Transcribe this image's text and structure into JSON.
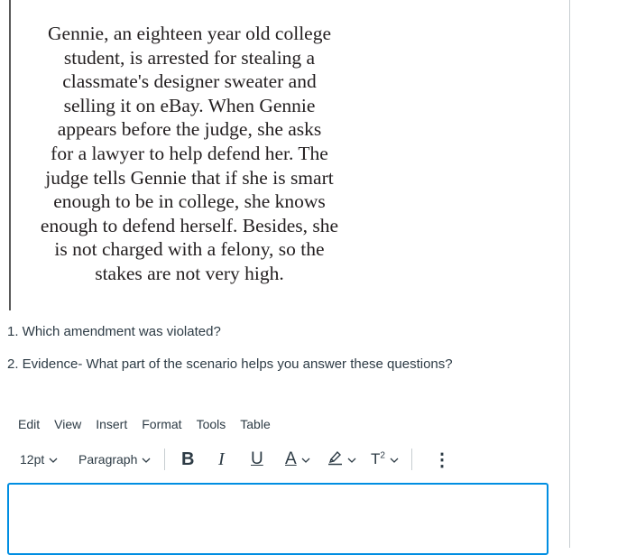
{
  "scenario": {
    "lines": [
      "Gennie, an eighteen year old college",
      "student, is arrested for stealing a",
      "classmate's designer sweater and",
      "selling it on eBay. When Gennie",
      "appears before the judge, she asks",
      "for a lawyer to help defend her. The",
      "judge tells Gennie that if she is smart",
      "enough to be in college, she knows",
      "enough to defend herself. Besides, she",
      "is not charged with a felony, so the",
      "stakes are not very high."
    ]
  },
  "questions": [
    "1. Which amendment was violated?",
    "2. Evidence- What part of the scenario helps you answer these questions?"
  ],
  "editor": {
    "menu": [
      "Edit",
      "View",
      "Insert",
      "Format",
      "Tools",
      "Table"
    ],
    "toolbar": {
      "font_size": "12pt",
      "block_format": "Paragraph",
      "bold_icon": "bold-icon",
      "italic_icon": "italic-icon",
      "underline_icon": "underline-icon",
      "text_color_icon": "text-color-icon",
      "highlight_icon": "highlight-color-icon",
      "superscript_icon": "superscript-icon",
      "more_icon": "more-vertical-icon"
    },
    "content": "",
    "focus_border_color": "#008ee2"
  }
}
